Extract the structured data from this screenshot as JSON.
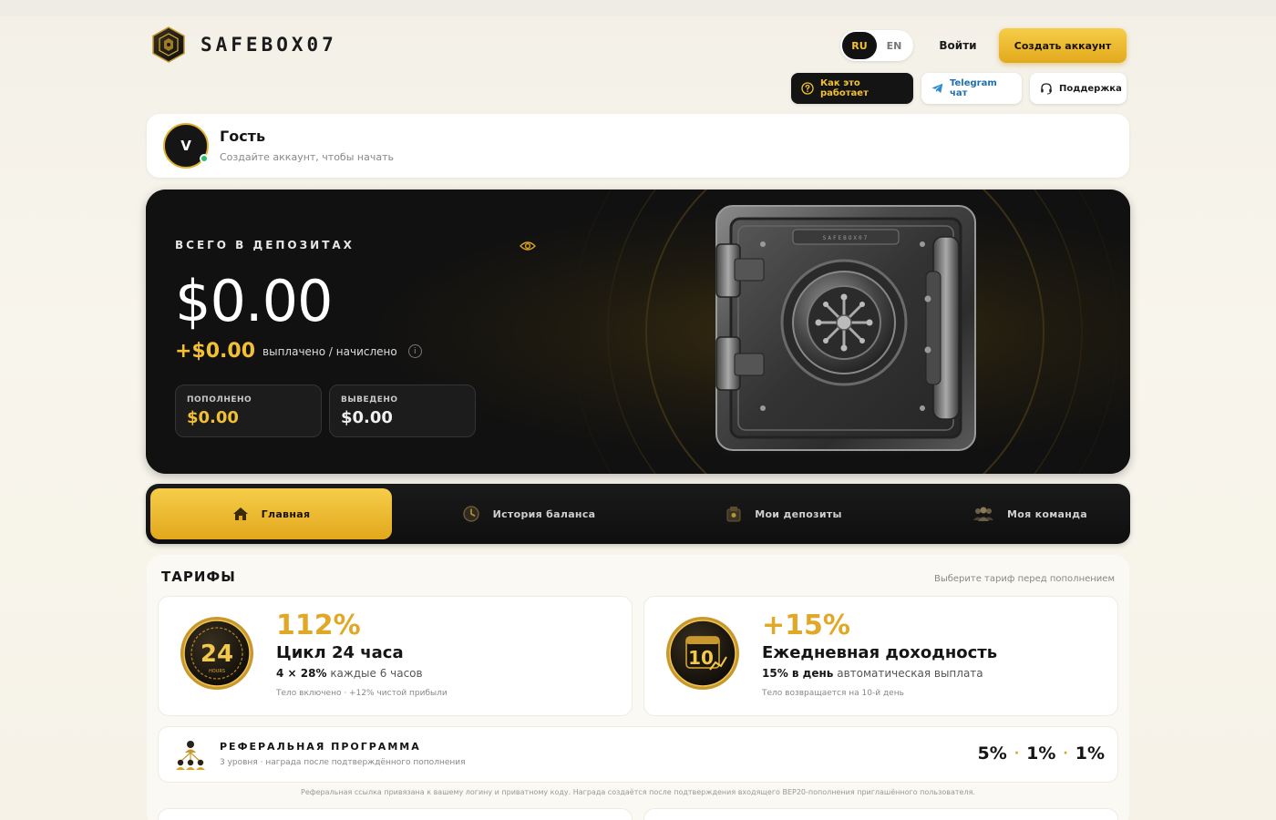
{
  "brand": {
    "name": "SAFEBOX07"
  },
  "header": {
    "lang": [
      "RU",
      "EN"
    ],
    "lang_active": "RU",
    "login": "Войти",
    "create_account": "Создать аккаунт",
    "how_it_works": "Как это работает",
    "telegram": "Telegram чат",
    "support": "Поддержка"
  },
  "user": {
    "initial": "V",
    "name": "Гость",
    "subtitle": "Создайте аккаунт, чтобы начать"
  },
  "balance": {
    "label": "ВСЕГО В ДЕПОЗИТАХ",
    "total": "$0.00",
    "paid": "+$0.00",
    "paid_label": "выплачено / начислено",
    "deposited_label": "ПОПОЛНЕНО",
    "deposited": "$0.00",
    "withdrawn_label": "ВЫВЕДЕНО",
    "withdrawn": "$0.00",
    "safe_plate": "SAFEBOX07"
  },
  "nav": [
    {
      "label": "Главная",
      "icon": "home-icon",
      "active": true
    },
    {
      "label": "История баланса",
      "icon": "history-icon",
      "active": false
    },
    {
      "label": "Мои депозиты",
      "icon": "deposit-icon",
      "active": false
    },
    {
      "label": "Моя команда",
      "icon": "team-icon",
      "active": false
    }
  ],
  "tariffs": {
    "title": "ТАРИФЫ",
    "hint": "Выберите тариф перед пополнением",
    "cards": [
      {
        "coin": "24",
        "coin_sub": "HOURS",
        "percent": "112%",
        "name": "Цикл 24 часа",
        "line_bold": "4 × 28%",
        "line_rest": "каждые 6 часов",
        "note": "Тело включено · +12% чистой прибыли"
      },
      {
        "coin": "10",
        "percent": "+15%",
        "name": "Ежедневная доходность",
        "line_bold": "15% в день",
        "line_rest": "автоматическая выплата",
        "note": "Тело возвращается на 10-й день"
      }
    ],
    "referral": {
      "title": "РЕФЕРАЛЬНАЯ ПРОГРАММА",
      "subtitle": "3 уровня · награда после подтверждённого пополнения",
      "levels": [
        "5%",
        "1%",
        "1%"
      ],
      "note": "Реферальная ссылка привязана к вашему логину и приватному коду. Награда создаётся после подтверждения входящего BEP20-пополнения приглашённого пользователя."
    }
  },
  "colors": {
    "gold": "#f2c033",
    "gold_dark": "#e0a826",
    "dark": "#111111",
    "online": "#28c46c"
  }
}
